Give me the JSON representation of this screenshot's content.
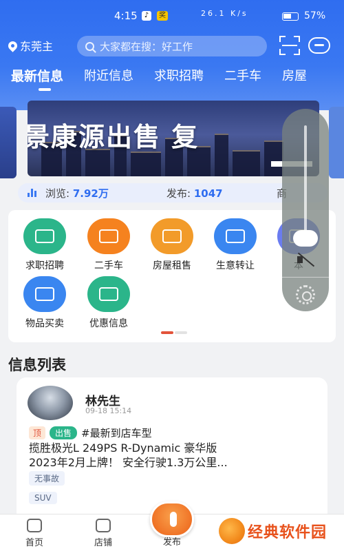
{
  "status_bar": {
    "time": "4:15",
    "app_glyph": "♪",
    "badge": "奖",
    "net_speed": "26.1 K/s",
    "battery_pct": "57%"
  },
  "header": {
    "location": "东莞主",
    "search_placeholder": "大家都在搜：好工作"
  },
  "tabs": [
    "最新信息",
    "附近信息",
    "求职招聘",
    "二手车",
    "房屋"
  ],
  "banner": {
    "headline": "景康源出售  复"
  },
  "stats": {
    "views_label": "浏览:",
    "views_value": "7.92万",
    "posts_label": "发布:",
    "posts_value": "1047",
    "more_label": "商"
  },
  "categories": [
    {
      "label": "求职招聘",
      "icon": "id-card-icon",
      "color": "#2bb58a"
    },
    {
      "label": "二手车",
      "icon": "car-icon",
      "color": "#f5821f"
    },
    {
      "label": "房屋租售",
      "icon": "house-icon",
      "color": "#f29b2a"
    },
    {
      "label": "生意转让",
      "icon": "shop-icon",
      "color": "#3a86f0"
    },
    {
      "label": "本",
      "icon": "local-icon",
      "color": "#6a7cf0"
    },
    {
      "label": "物品买卖",
      "icon": "price-tag-icon",
      "color": "#3a86f0"
    },
    {
      "label": "优惠信息",
      "icon": "coupon-icon",
      "color": "#2bb58a"
    }
  ],
  "carousel": {
    "active_page": 1,
    "total_pages": 2
  },
  "volume": {
    "level": 0.1
  },
  "list": {
    "title": "信息列表",
    "post": {
      "author": "林先生",
      "time": "09-18 15:14",
      "tag_top": "顶",
      "tag_sell": "出售",
      "hashtag": "#最新到店车型",
      "line1": "揽胜极光L 249PS R-Dynamic 豪华版",
      "line2": "2023年2月上牌！ 安全行驶1.3万公里...",
      "chip1": "无事故",
      "chip2": "SUV"
    }
  },
  "bottom_nav": {
    "home": "首页",
    "shop": "店铺",
    "publish": "发布"
  },
  "watermark": "经典软件园"
}
